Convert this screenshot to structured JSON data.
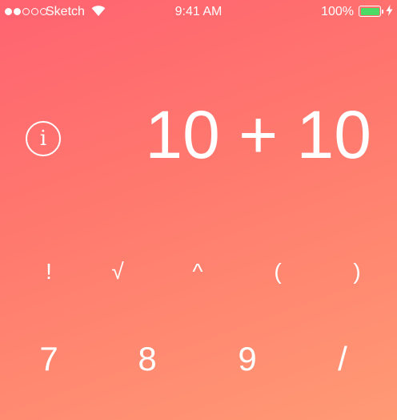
{
  "status_bar": {
    "carrier": "Sketch",
    "time": "9:41 AM",
    "battery_percent": "100%",
    "signal_bars_filled": 2,
    "signal_bars_total": 5,
    "battery_level": 1.0,
    "battery_color": "#4cd964",
    "icons": [
      "wifi-icon",
      "battery-icon",
      "charging-bolt-icon"
    ]
  },
  "display": {
    "expression": "10 + 10",
    "info_glyph": "i"
  },
  "keypad": {
    "functions": [
      "!",
      "√",
      "^",
      "(",
      ")"
    ],
    "digits": [
      "7",
      "8",
      "9",
      "/"
    ]
  },
  "theme": {
    "gradient_start": "#ff6370",
    "gradient_end": "#ff9a74",
    "text_color": "#ffffff"
  }
}
